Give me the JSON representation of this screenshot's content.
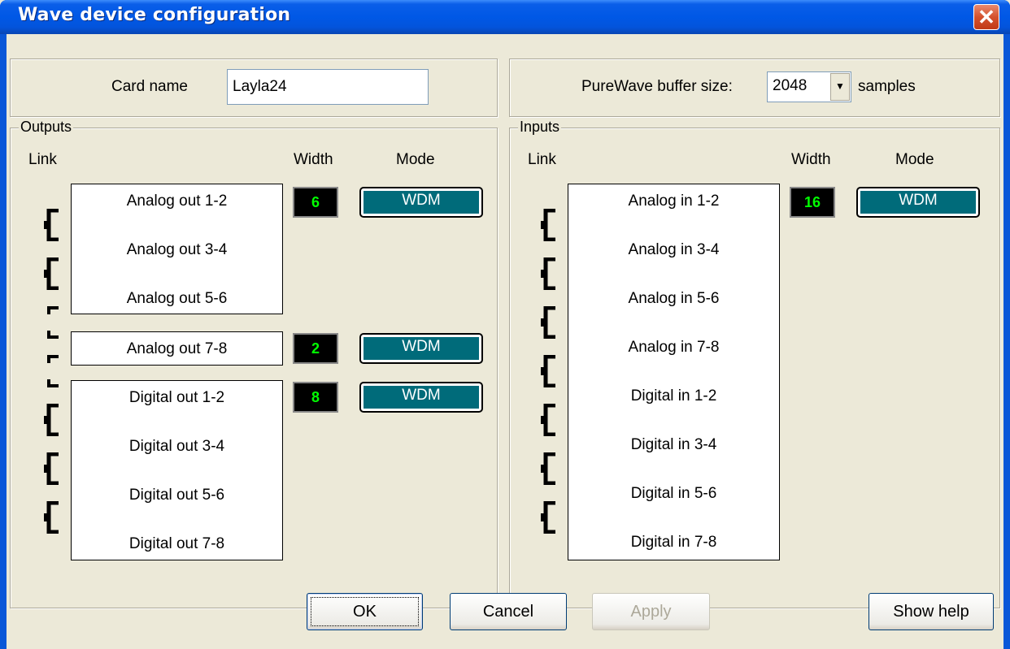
{
  "window": {
    "title": "Wave device configuration",
    "close": "✕"
  },
  "card": {
    "label": "Card name",
    "value": "Layla24"
  },
  "buffer": {
    "label": "PureWave buffer size:",
    "value": "2048",
    "unit": "samples"
  },
  "outputs": {
    "group_label": "Outputs",
    "col_link": "Link",
    "col_width": "Width",
    "col_mode": "Mode",
    "channels": [
      "Analog out 1-2",
      "Analog out 3-4",
      "Analog out 5-6",
      "Analog out 7-8",
      "Digital out 1-2",
      "Digital out 3-4",
      "Digital out 5-6",
      "Digital out 7-8"
    ],
    "groups": [
      {
        "width": "6",
        "mode": "WDM"
      },
      {
        "width": "2",
        "mode": "WDM"
      },
      {
        "width": "8",
        "mode": "WDM"
      }
    ]
  },
  "inputs": {
    "group_label": "Inputs",
    "col_link": "Link",
    "col_width": "Width",
    "col_mode": "Mode",
    "channels": [
      "Analog in 1-2",
      "Analog in 3-4",
      "Analog in 5-6",
      "Analog in 7-8",
      "Digital in 1-2",
      "Digital in 3-4",
      "Digital in 5-6",
      "Digital in 7-8"
    ],
    "groups": [
      {
        "width": "16",
        "mode": "WDM"
      }
    ]
  },
  "buttons": {
    "ok": "OK",
    "cancel": "Cancel",
    "apply": "Apply",
    "help": "Show help"
  },
  "colors": {
    "title_bar": "#0058e6",
    "mode_fill": "#006b7a",
    "width_text": "#00ff00"
  }
}
